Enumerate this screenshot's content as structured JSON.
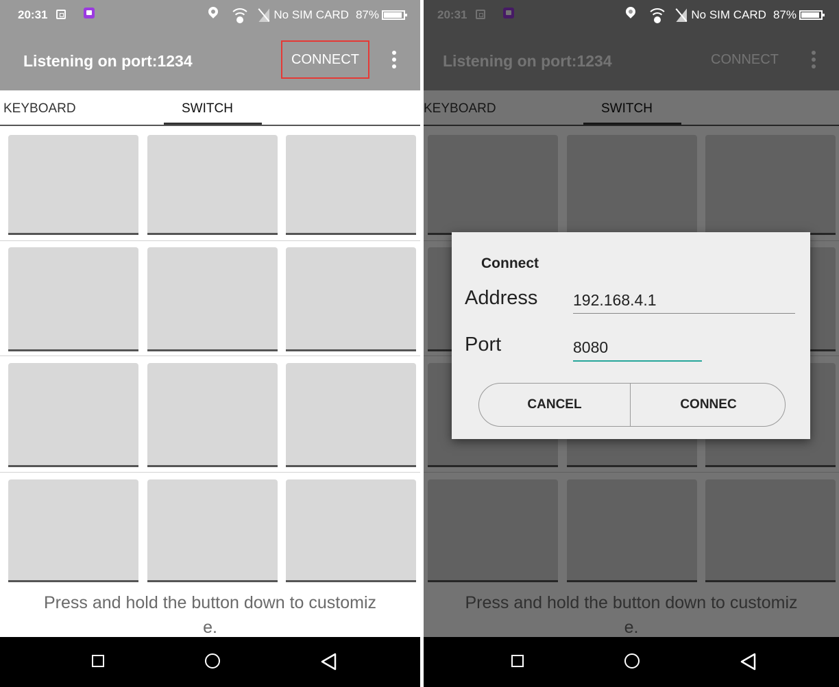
{
  "status_bar": {
    "time": "20:31",
    "sim_text": "No SIM CARD",
    "battery": "87%",
    "icons": [
      "screenshot-icon",
      "camera-app-icon",
      "location-icon",
      "wifi-icon",
      "no-sim-icon",
      "battery-icon"
    ]
  },
  "app_bar": {
    "title": "Listening on port:1234",
    "connect_label": "CONNECT",
    "overflow_icon": "more-vert-icon",
    "highlight_color": "#e53935"
  },
  "tabs": [
    {
      "label": "KEYBOARD"
    },
    {
      "label": "SWITCH"
    }
  ],
  "active_tab": "SWITCH",
  "hint": {
    "line1": "Press and hold the button down to customiz",
    "line2": "e."
  },
  "nav": {
    "icons": [
      "recents-icon",
      "home-icon",
      "back-icon"
    ]
  },
  "dialog": {
    "title": "Connect",
    "address_label": "Address",
    "address_value": "192.168.4.1",
    "port_label": "Port",
    "port_value": "8080",
    "cancel_label": "CANCEL",
    "connect_label": "CONNEC",
    "accent_color": "#26a69a"
  }
}
